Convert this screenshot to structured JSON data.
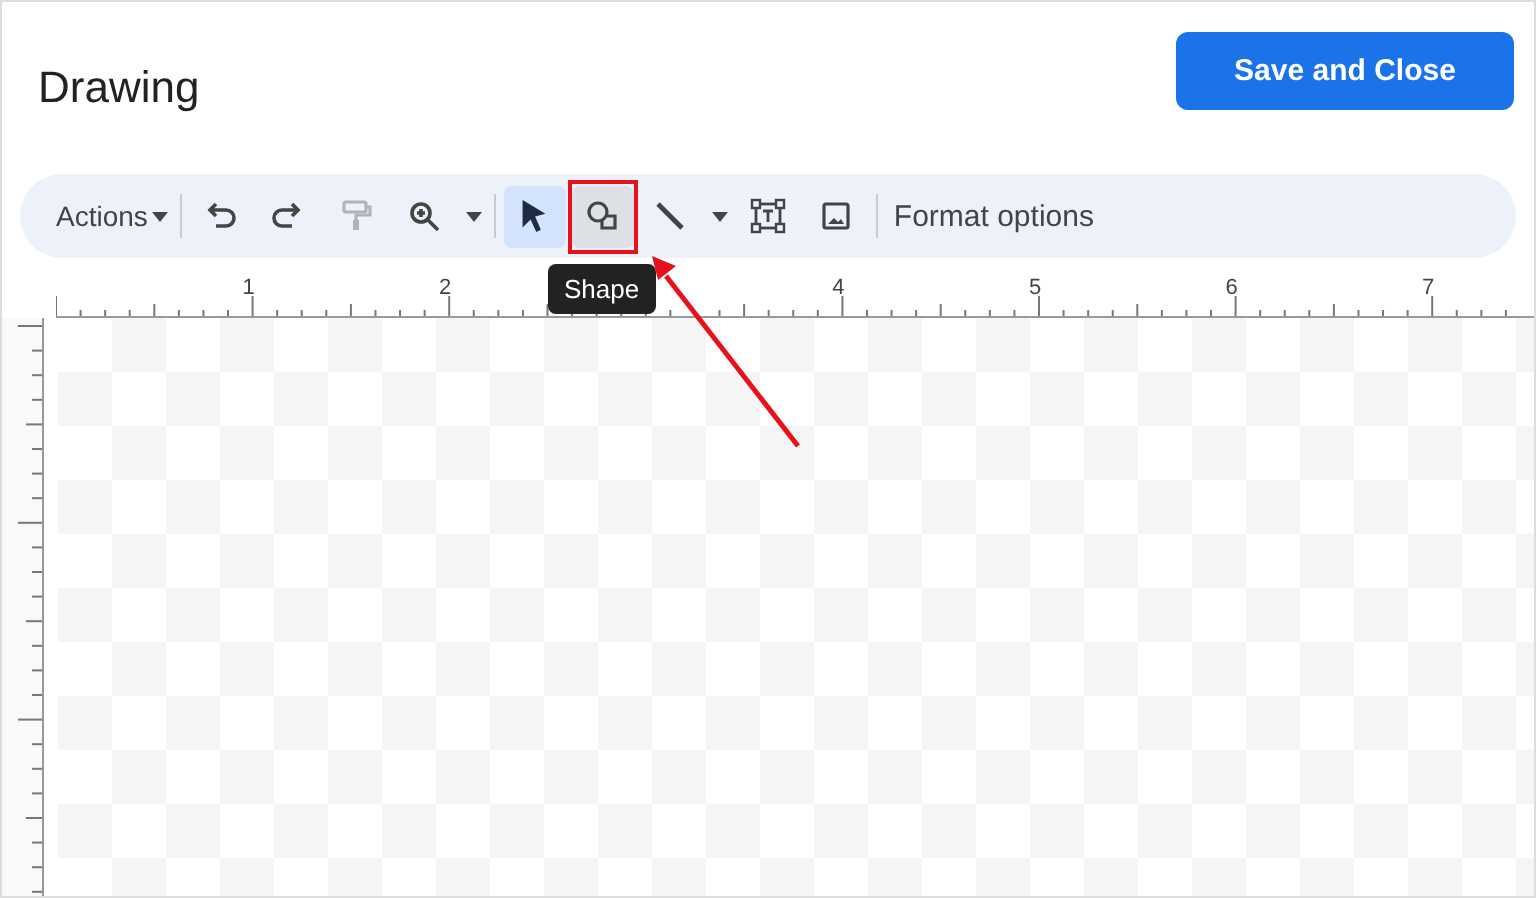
{
  "header": {
    "title": "Drawing",
    "save_button": "Save and Close"
  },
  "toolbar": {
    "groups": [
      [
        {
          "kind": "menu",
          "label": "Actions"
        }
      ],
      [
        {
          "kind": "undo",
          "selected": false,
          "disabled": false,
          "hovered": false
        },
        {
          "kind": "redo",
          "selected": false,
          "disabled": false,
          "hovered": false
        },
        {
          "kind": "paint-format",
          "selected": false,
          "disabled": true,
          "hovered": false
        },
        {
          "kind": "zoom",
          "selected": false,
          "disabled": false,
          "hovered": false,
          "dropdown": true
        }
      ],
      [
        {
          "kind": "select",
          "selected": true,
          "disabled": false,
          "hovered": false
        },
        {
          "kind": "shape",
          "selected": false,
          "disabled": false,
          "hovered": true
        },
        {
          "kind": "line",
          "selected": false,
          "disabled": false,
          "hovered": false,
          "dropdown": true
        },
        {
          "kind": "text-box",
          "selected": false,
          "disabled": false,
          "hovered": false
        },
        {
          "kind": "image",
          "selected": false,
          "disabled": false,
          "hovered": false
        }
      ],
      [
        {
          "kind": "text-button",
          "label": "Format options"
        }
      ]
    ]
  },
  "tooltip": "Shape",
  "ruler": {
    "labels_before_tooltip": [
      "1",
      "2"
    ],
    "labels_after_tooltip": [
      "4",
      "5",
      "6",
      "7"
    ]
  }
}
